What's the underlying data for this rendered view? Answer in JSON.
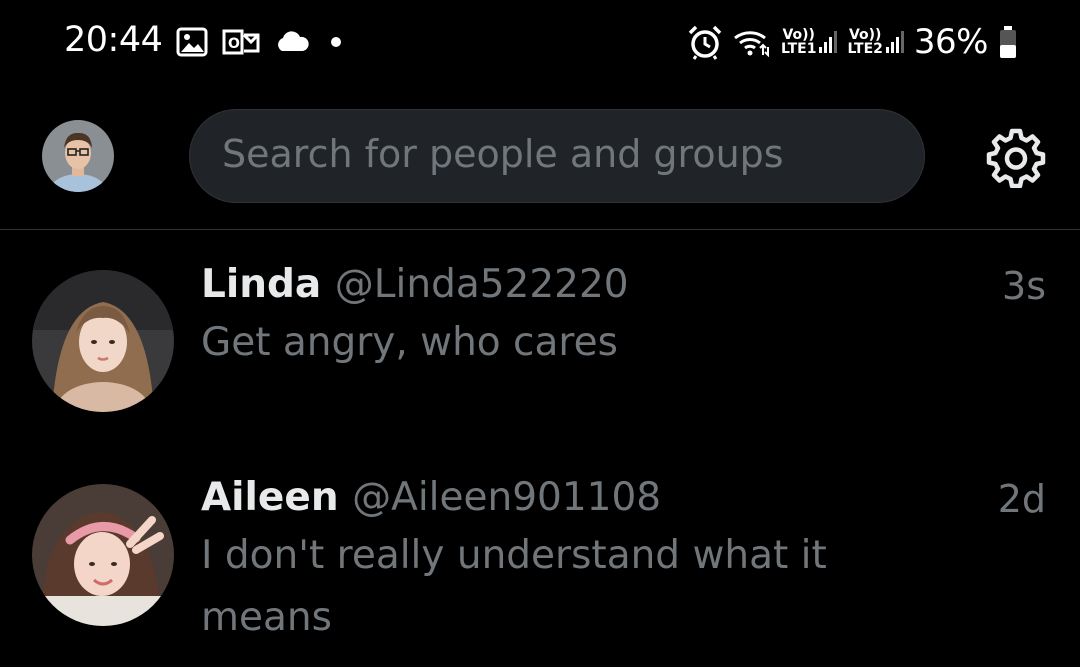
{
  "status_bar": {
    "time": "20:44",
    "battery": "36%",
    "sim1_tag": "Vo))",
    "sim1_lte": "LTE1",
    "sim2_tag": "Vo))",
    "sim2_lte": "LTE2"
  },
  "header": {
    "search_placeholder": "Search for people and groups"
  },
  "conversations": [
    {
      "name": "Linda",
      "handle": "@Linda522220",
      "time": "3s",
      "message": "Get angry, who cares"
    },
    {
      "name": "Aileen",
      "handle": "@Aileen901108",
      "time": "2d",
      "message": "I don't really understand what it means"
    }
  ],
  "colors": {
    "background": "#000000",
    "search_bg": "#202327",
    "muted_text": "#71767b",
    "primary_text": "#e7e9ea"
  }
}
